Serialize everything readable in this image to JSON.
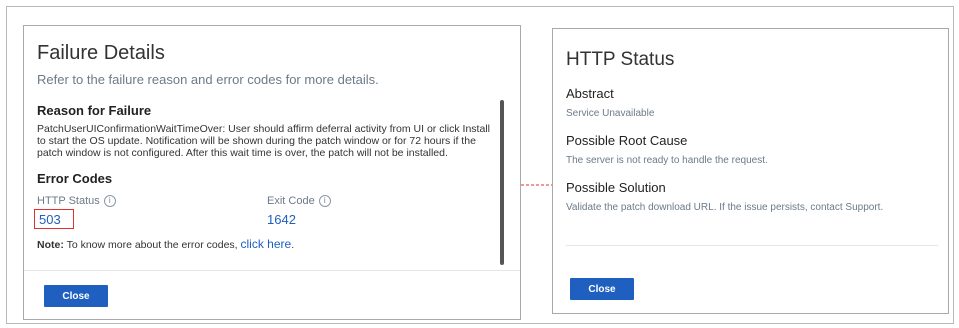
{
  "failure_details": {
    "title": "Failure Details",
    "subtitle": "Refer to the failure reason and error codes for more details.",
    "reason_heading": "Reason for Failure",
    "reason_lines": [
      "PatchUserUIConfirmationWaitTimeOver: User should affirm deferral activity from UI or click Install",
      "to start the OS update. Notification will be shown during the patch window or for 72 hours if the",
      "patch window is not configured. After this wait time is over, the patch will not be installed."
    ],
    "error_codes_heading": "Error Codes",
    "http_status_label": "HTTP Status",
    "http_status_value": "503",
    "exit_code_label": "Exit Code",
    "exit_code_value": "1642",
    "note_prefix": "Note:",
    "note_text": " To know more about the error codes, ",
    "note_link": "click here",
    "note_suffix": ".",
    "close_label": "Close"
  },
  "http_status_panel": {
    "title": "HTTP Status",
    "abstract_heading": "Abstract",
    "abstract_text": "Service Unavailable",
    "root_cause_heading": "Possible Root Cause",
    "root_cause_text": "The server is not ready to handle the request.",
    "solution_heading": "Possible Solution",
    "solution_text": "Validate the patch download URL. If the issue persists, contact Support.",
    "close_label": "Close"
  },
  "colors": {
    "accent": "#1f5fbf",
    "highlight": "#e03030",
    "muted_text": "#6c7a89"
  },
  "icons": [
    "info-icon",
    "info-icon"
  ]
}
